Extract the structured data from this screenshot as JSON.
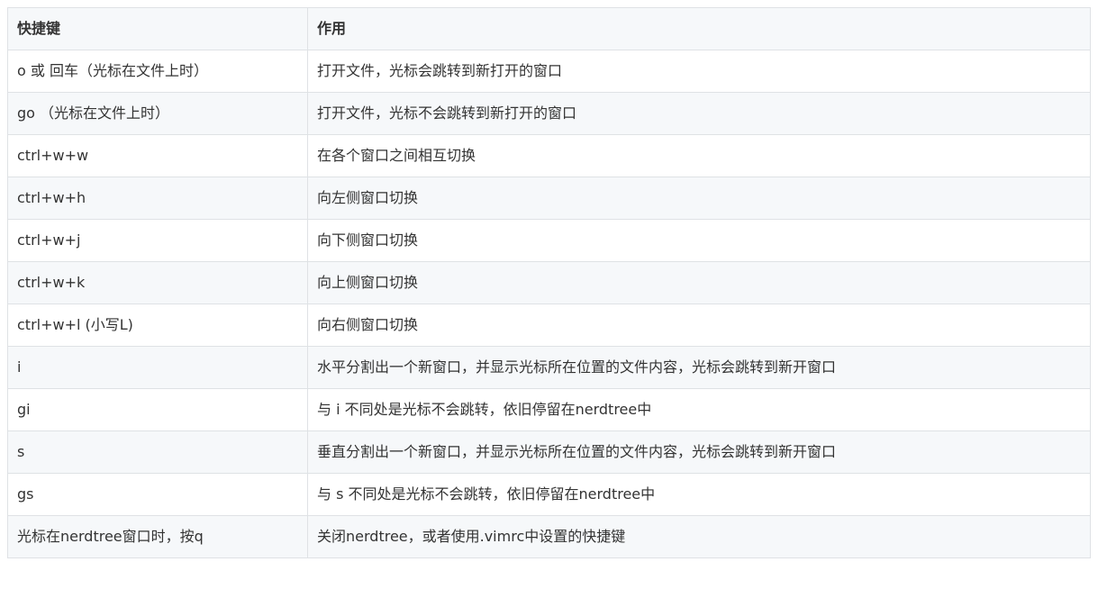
{
  "table": {
    "headers": [
      "快捷键",
      "作用"
    ],
    "rows": [
      [
        "o 或 回车（光标在文件上时）",
        "打开文件，光标会跳转到新打开的窗口"
      ],
      [
        "go （光标在文件上时）",
        "打开文件，光标不会跳转到新打开的窗口"
      ],
      [
        "ctrl+w+w",
        "在各个窗口之间相互切换"
      ],
      [
        "ctrl+w+h",
        "向左侧窗口切换"
      ],
      [
        "ctrl+w+j",
        "向下侧窗口切换"
      ],
      [
        "ctrl+w+k",
        "向上侧窗口切换"
      ],
      [
        "ctrl+w+l (小写L)",
        "向右侧窗口切换"
      ],
      [
        "i",
        "水平分割出一个新窗口，并显示光标所在位置的文件内容，光标会跳转到新开窗口"
      ],
      [
        "gi",
        "与 i 不同处是光标不会跳转，依旧停留在nerdtree中"
      ],
      [
        "s",
        "垂直分割出一个新窗口，并显示光标所在位置的文件内容，光标会跳转到新开窗口"
      ],
      [
        "gs",
        "与 s 不同处是光标不会跳转，依旧停留在nerdtree中"
      ],
      [
        "光标在nerdtree窗口时，按q",
        "关闭nerdtree，或者使用.vimrc中设置的快捷键"
      ]
    ]
  },
  "colors": {
    "border": "#dfe2e5",
    "header_bg": "#f6f8fa",
    "stripe_bg": "#f6f8fa",
    "text": "#333333"
  }
}
